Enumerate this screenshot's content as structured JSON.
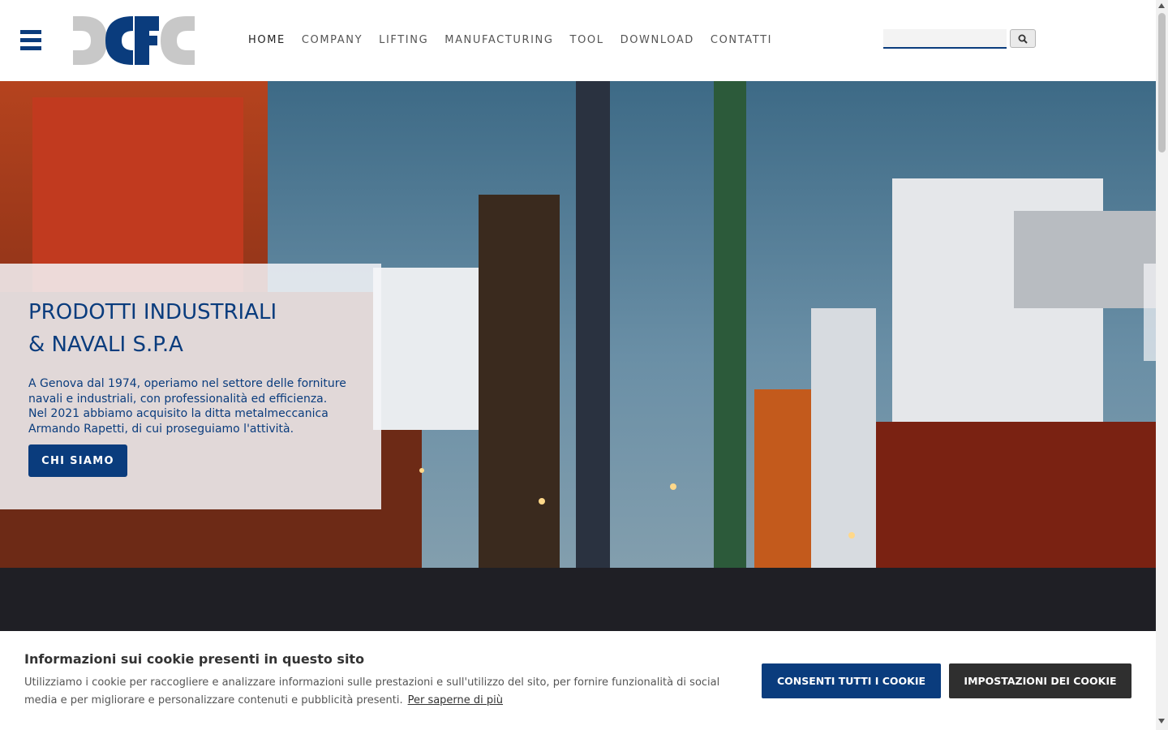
{
  "header": {
    "logo_text": "DCFC",
    "nav": [
      "HOME",
      "COMPANY",
      "LIFTING",
      "MANUFACTURING",
      "TOOL",
      "DOWNLOAD",
      "CONTATTI"
    ],
    "search": {
      "value": "",
      "icon": "search-icon"
    },
    "menu_icon": "hamburger-icon"
  },
  "hero": {
    "image": "shipyard-cranes-at-dusk",
    "title_line1": "PRODOTTI INDUSTRIALI",
    "title_line2": "& NAVALI S.P.A",
    "text": "A Genova dal 1974, operiamo nel settore delle forniture navali e industriali, con professionalità ed efficienza. Nel 2021 abbiamo acquisito la ditta metalmeccanica Armando Rapetti, di cui proseguiamo l'attività.",
    "cta": "CHI SIAMO"
  },
  "cookie": {
    "title": "Informazioni sui cookie presenti in questo sito",
    "text": "Utilizziamo i cookie per raccogliere e analizzare informazioni sulle prestazioni e sull'utilizzo del sito, per fornire funzionalità di social media e per migliorare e personalizzare contenuti e pubblicità presenti.",
    "link": "Per saperne di più",
    "accept_label": "CONSENTI TUTTI I COOKIE",
    "settings_label": "IMPOSTAZIONI DEI COOKIE"
  },
  "colors": {
    "brand_blue": "#0a3c7d",
    "logo_gray": "#c8c8c8",
    "dark_button": "#2f2f2f"
  }
}
